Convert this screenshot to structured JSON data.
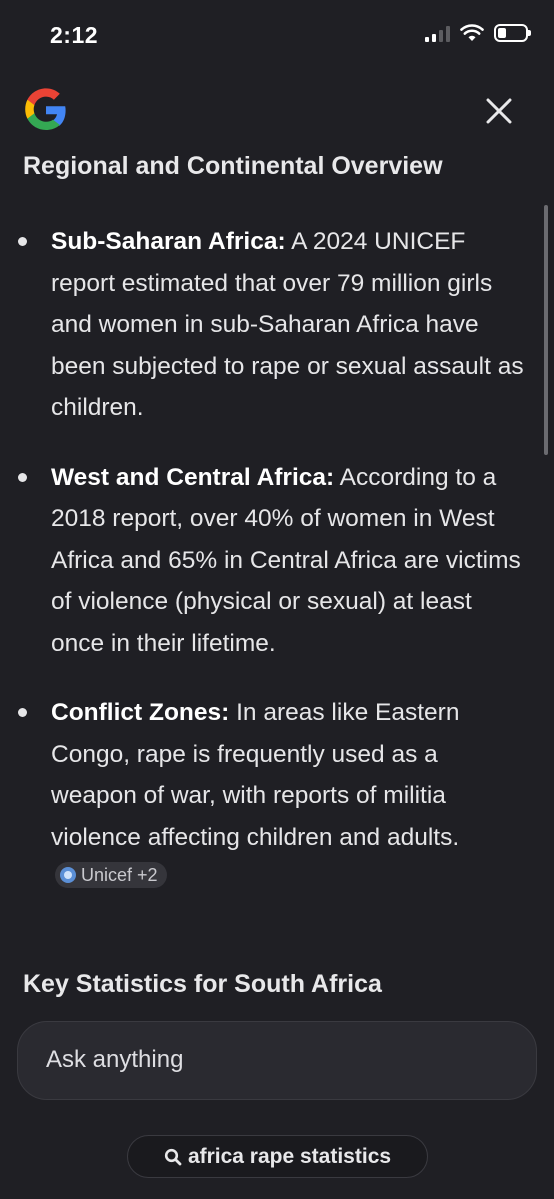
{
  "status_bar": {
    "time": "2:12"
  },
  "header": {
    "logo": "google-g-logo",
    "close_icon": "close-icon"
  },
  "section1": {
    "title": "Regional and Continental Overview",
    "bullets": [
      {
        "label": "Sub-Saharan Africa:",
        "text": " A 2024 UNICEF report estimated that over 79 million girls and women in sub-Saharan Africa have been subjected to rape or sexual assault as children."
      },
      {
        "label": "West and Central Africa:",
        "text": " According to a 2018 report, over 40% of women in West Africa and 65% in Central Africa are victims of violence (physical or sexual) at least once in their lifetime."
      },
      {
        "label": "Conflict Zones:",
        "text": " In areas like Eastern Congo, rape is frequently used as a weapon of war, with reports of militia violence affecting children and adults.",
        "source_chip": "Unicef +2"
      }
    ]
  },
  "section2": {
    "title": "Key Statistics for South Africa"
  },
  "input": {
    "placeholder": "Ask anything"
  },
  "query_pill": {
    "icon": "search-icon",
    "text": "africa rape statistics"
  },
  "colors": {
    "background": "#1f1f24",
    "text": "#e8e8ea",
    "chip_bg": "#35353b"
  }
}
